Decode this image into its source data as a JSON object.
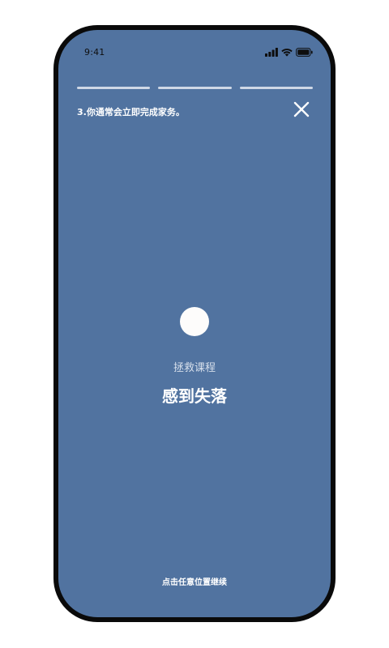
{
  "status_bar": {
    "time": "9:41",
    "icons": [
      "signal-icon",
      "wifi-icon",
      "battery-icon"
    ]
  },
  "progress": {
    "segments": 3
  },
  "header": {
    "question": "3.你通常会立即完成家务。",
    "close_icon": "close-icon"
  },
  "content": {
    "dot_icon": "circle-icon",
    "subtitle": "拯救课程",
    "title": "感到失落"
  },
  "footer": {
    "hint": "点击任意位置继续"
  },
  "colors": {
    "background": "#5173a0",
    "frame": "#0a0a0a",
    "text": "#ffffff",
    "subtitle": "#d6dfeb",
    "progress": "#cfd8e6"
  }
}
